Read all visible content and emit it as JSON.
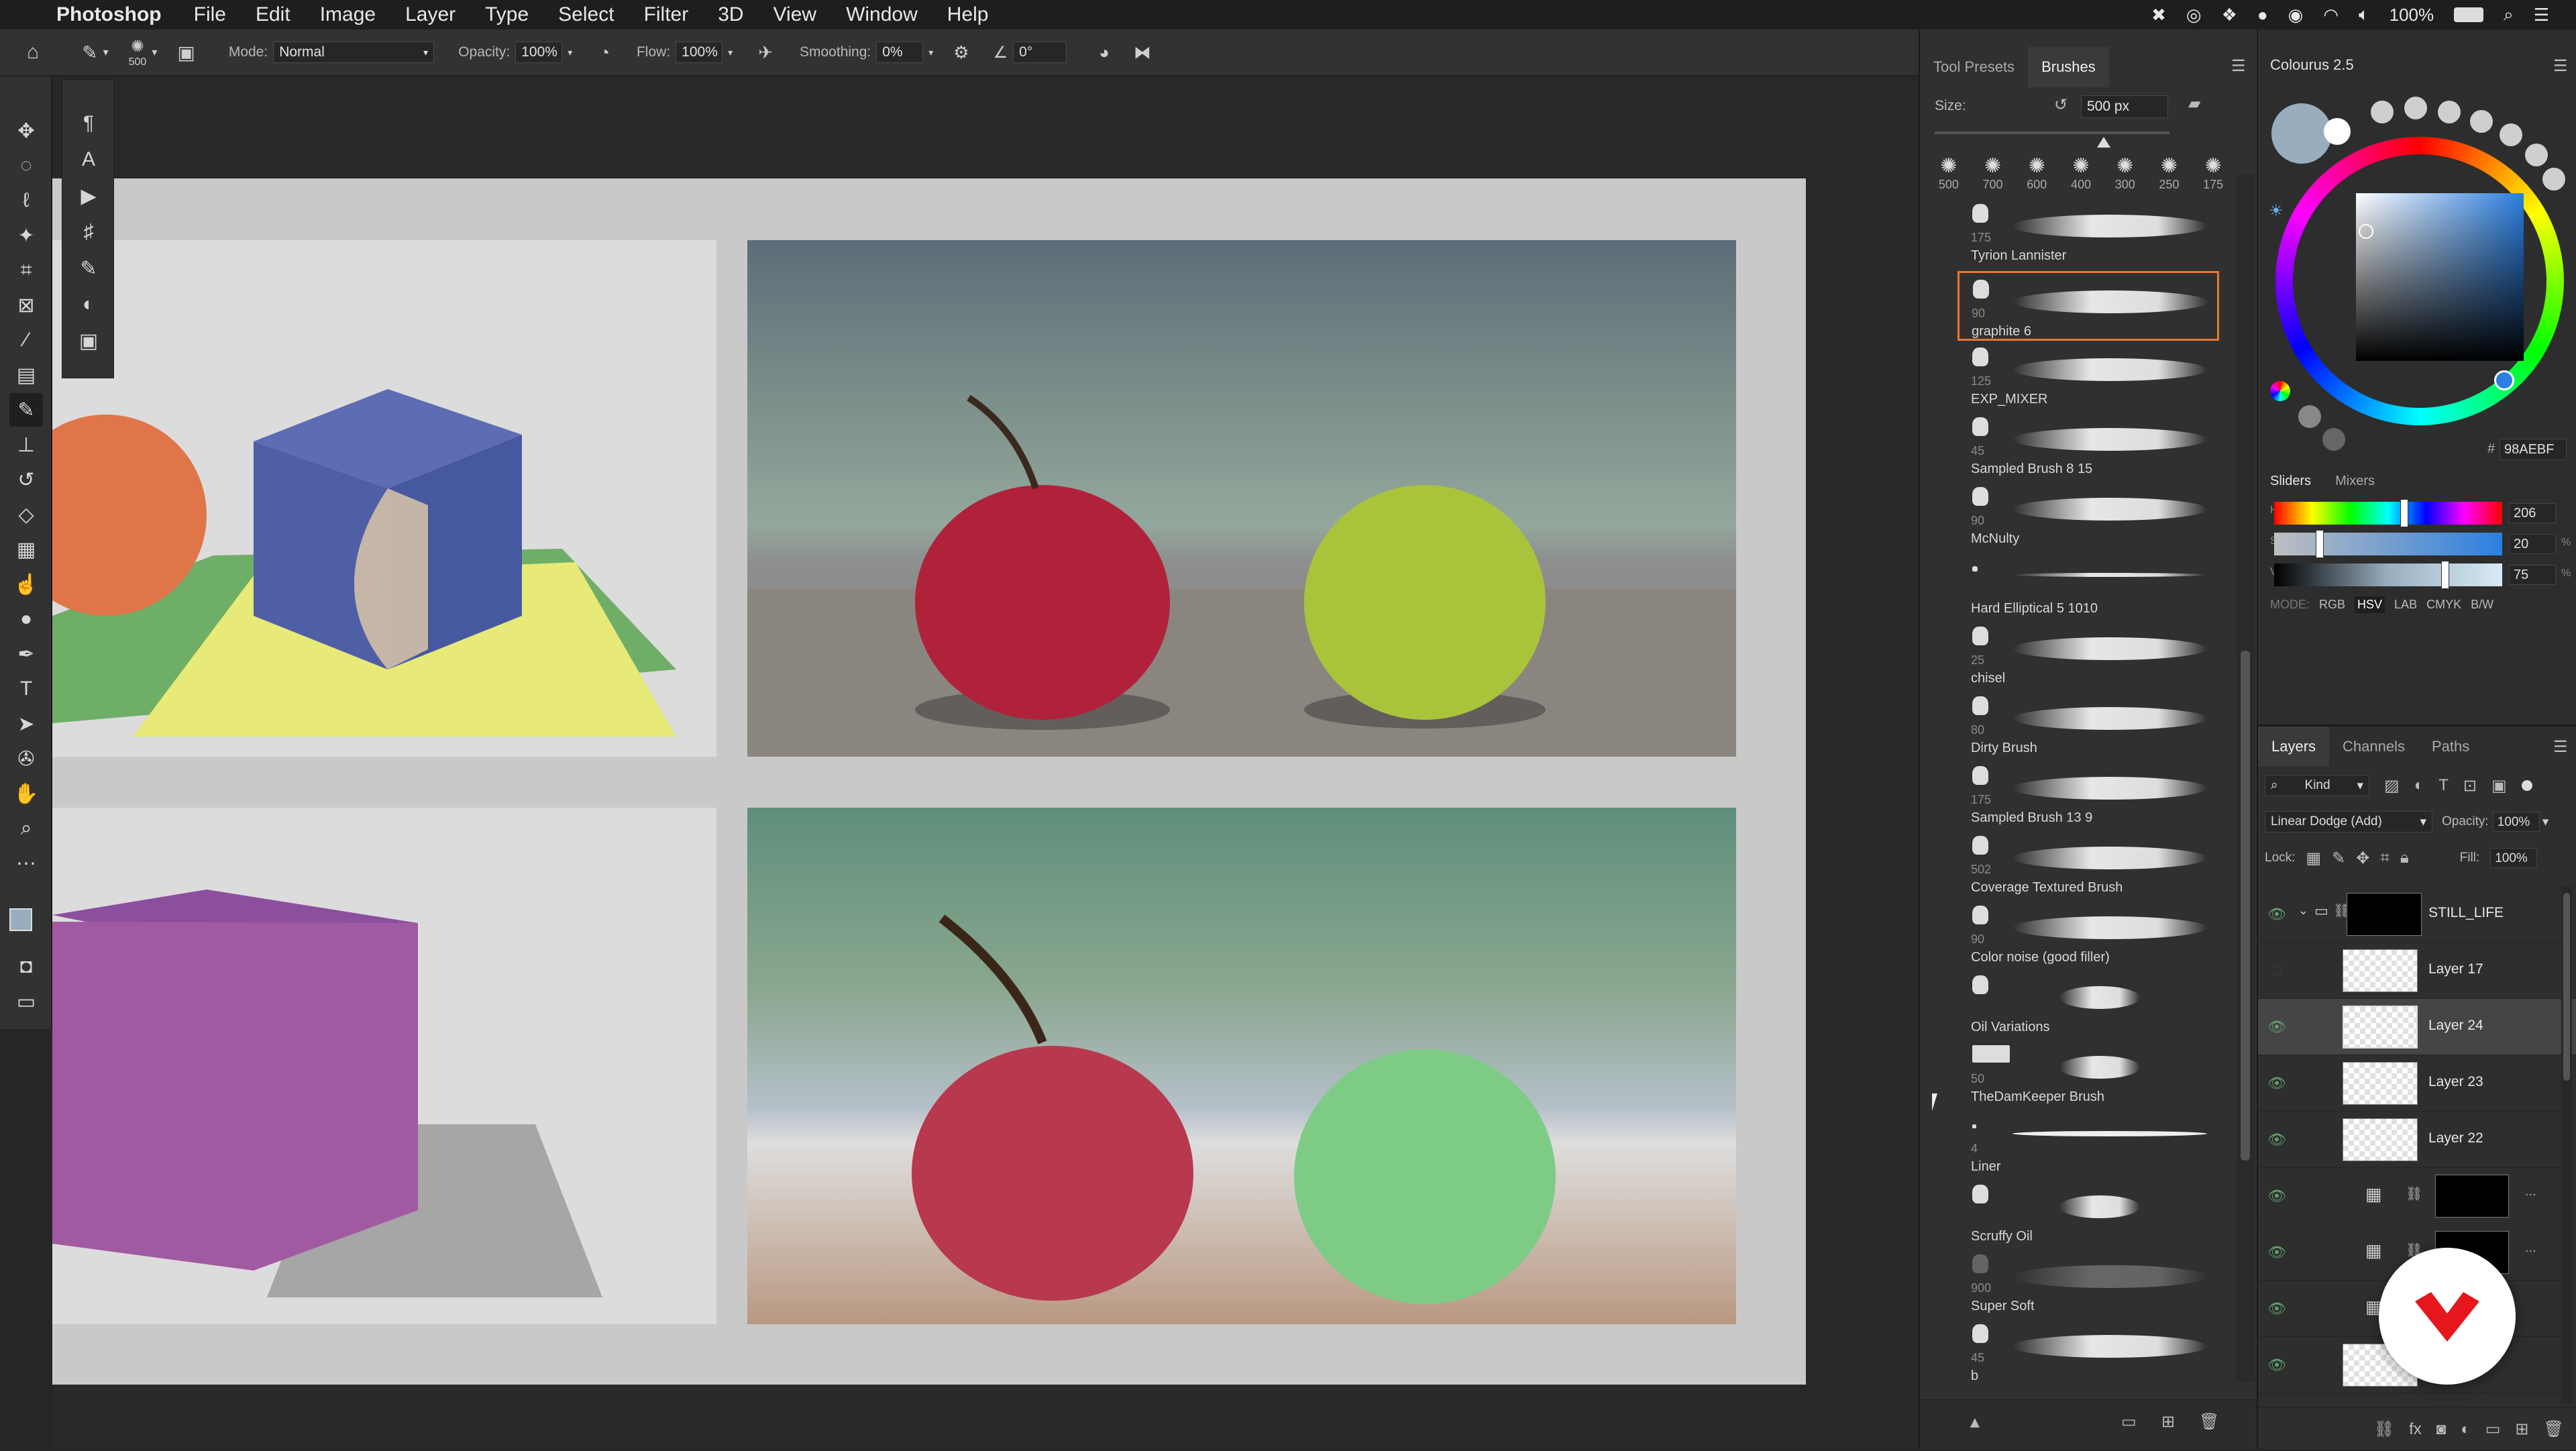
{
  "menubar": {
    "apple": "",
    "app_name": "Photoshop",
    "menus": [
      "File",
      "Edit",
      "Image",
      "Layer",
      "Type",
      "Select",
      "Filter",
      "3D",
      "View",
      "Window",
      "Help"
    ],
    "battery": "100%"
  },
  "options": {
    "brush_size": "500",
    "mode_label": "Mode:",
    "mode_value": "Normal",
    "opacity_label": "Opacity:",
    "opacity_value": "100%",
    "flow_label": "Flow:",
    "flow_value": "100%",
    "smoothing_label": "Smoothing:",
    "smoothing_value": "0%",
    "angle_value": "0°"
  },
  "brush_panel": {
    "tabs": [
      "Tool Presets",
      "Brushes"
    ],
    "size_label": "Size:",
    "size_value": "500 px",
    "size_fraction": 0.72,
    "preset_sizes": [
      "500",
      "700",
      "600",
      "400",
      "300",
      "250",
      "175"
    ],
    "brushes": [
      {
        "size": "175",
        "name": "Tyrion Lannister"
      },
      {
        "size": "90",
        "name": "graphite 6",
        "selected": true
      },
      {
        "size": "125",
        "name": "EXP_MIXER"
      },
      {
        "size": "45",
        "name": "Sampled Brush 8 15"
      },
      {
        "size": "90",
        "name": "McNulty"
      },
      {
        "size": "",
        "name": "Hard Elliptical 5 1010"
      },
      {
        "size": "25",
        "name": "chisel"
      },
      {
        "size": "80",
        "name": "Dirty Brush"
      },
      {
        "size": "175",
        "name": "Sampled Brush 13 9"
      },
      {
        "size": "502",
        "name": "Coverage Textured Brush"
      },
      {
        "size": "90",
        "name": "Color noise (good filler)"
      },
      {
        "size": "",
        "name": "Oil Variations"
      },
      {
        "size": "50",
        "name": "TheDamKeeper Brush"
      },
      {
        "size": "4",
        "name": "Liner"
      },
      {
        "size": "",
        "name": "Scruffy Oil"
      },
      {
        "size": "900",
        "name": "Super Soft"
      },
      {
        "size": "45",
        "name": "b"
      }
    ]
  },
  "colour_panel": {
    "title": "Colourus 2.5",
    "hex": "98AEBF",
    "slider_tabs": [
      "Sliders",
      "Mixers"
    ],
    "sliders": [
      {
        "label": "H",
        "value": "206",
        "unit": "",
        "fraction": 0.57
      },
      {
        "label": "S",
        "value": "20",
        "unit": "%",
        "fraction": 0.2
      },
      {
        "label": "V",
        "value": "75",
        "unit": "%",
        "fraction": 0.75
      }
    ],
    "mode_label": "MODE:",
    "modes": [
      "RGB",
      "HSV",
      "LAB",
      "CMYK",
      "B/W"
    ],
    "active_mode": "HSV"
  },
  "layers_panel": {
    "tabs": [
      "Layers",
      "Channels",
      "Paths"
    ],
    "kind_label": "Kind",
    "blend_mode": "Linear Dodge (Add)",
    "opacity_label": "Opacity:",
    "opacity_value": "100%",
    "lock_label": "Lock:",
    "fill_label": "Fill:",
    "fill_value": "100%",
    "layers": [
      {
        "name": "STILL_LIFE",
        "visible": true,
        "group": true
      },
      {
        "name": "Layer 17",
        "visible": false
      },
      {
        "name": "Layer 24",
        "visible": true,
        "selected": true
      },
      {
        "name": "Layer 23",
        "visible": true
      },
      {
        "name": "Layer 22",
        "visible": true
      },
      {
        "name": "",
        "visible": true,
        "adjustment": true
      },
      {
        "name": "",
        "visible": true,
        "adjustment": true
      },
      {
        "name": "",
        "visible": true,
        "adjustment": true
      },
      {
        "name": "",
        "visible": true
      }
    ],
    "more_label": "..."
  },
  "colors": {
    "accent": "#e8772b",
    "foreground": "#98AEBF",
    "eye_green": "#5fa06b",
    "brand_red": "#e5161c"
  }
}
